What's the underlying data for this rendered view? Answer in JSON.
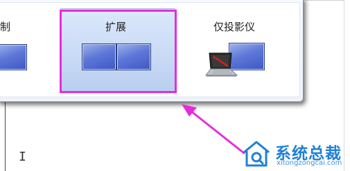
{
  "projection_menu": {
    "options": [
      {
        "label": "制",
        "selected": false
      },
      {
        "label": "扩展",
        "selected": true
      },
      {
        "label": "仅投影仪",
        "selected": false
      }
    ]
  },
  "annotation": {
    "highlight_color": "#e82bd9",
    "arrow_color": "#e82bd9"
  },
  "watermark": {
    "title": "系统总裁",
    "url": "xitongzongcai.com",
    "color": "#1f7fd6"
  }
}
